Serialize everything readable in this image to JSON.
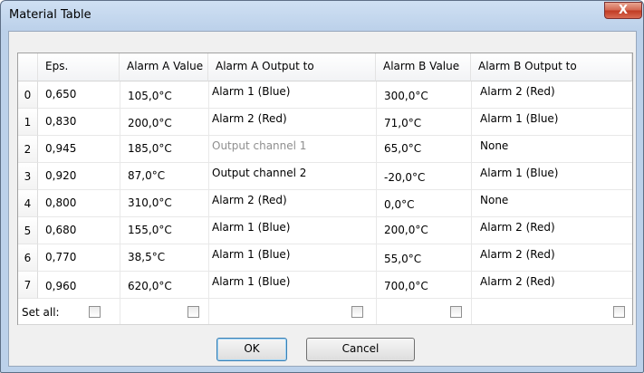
{
  "window": {
    "title": "Material Table",
    "close_glyph": "X"
  },
  "table": {
    "columns": [
      "Eps.",
      "Alarm A Value",
      "Alarm A Output to",
      "Alarm B Value",
      "Alarm B Output to"
    ],
    "rows": [
      {
        "index": "0",
        "eps": "0,650",
        "a_value": "105,0°C",
        "a_output": "Alarm 1 (Blue)",
        "b_value": "300,0°C",
        "b_output": "Alarm 2 (Red)"
      },
      {
        "index": "1",
        "eps": "0,830",
        "a_value": "200,0°C",
        "a_output": "Alarm 2 (Red)",
        "b_value": "71,0°C",
        "b_output": "Alarm 1 (Blue)"
      },
      {
        "index": "2",
        "eps": "0,945",
        "a_value": "185,0°C",
        "a_output": "Output channel 1",
        "b_value": "65,0°C",
        "b_output": "None"
      },
      {
        "index": "3",
        "eps": "0,920",
        "a_value": "87,0°C",
        "a_output": "Output channel 2",
        "b_value": "-20,0°C",
        "b_output": "Alarm 1 (Blue)"
      },
      {
        "index": "4",
        "eps": "0,800",
        "a_value": "310,0°C",
        "a_output": "Alarm 2 (Red)",
        "b_value": "0,0°C",
        "b_output": "None"
      },
      {
        "index": "5",
        "eps": "0,680",
        "a_value": "155,0°C",
        "a_output": "Alarm 1 (Blue)",
        "b_value": "200,0°C",
        "b_output": "Alarm 2 (Red)"
      },
      {
        "index": "6",
        "eps": "0,770",
        "a_value": "38,5°C",
        "a_output": "Alarm 1 (Blue)",
        "b_value": "55,0°C",
        "b_output": "Alarm 2 (Red)"
      },
      {
        "index": "7",
        "eps": "0,960",
        "a_value": "620,0°C",
        "a_output": "Alarm 1 (Blue)",
        "b_value": "700,0°C",
        "b_output": "Alarm 2 (Red)"
      }
    ],
    "set_all_label": "Set all:"
  },
  "buttons": {
    "ok": "OK",
    "cancel": "Cancel"
  },
  "colors": {
    "title_bar": "#bcd1ea",
    "close_button": "#c03a22",
    "disabled_text": "#8f8f8f"
  }
}
